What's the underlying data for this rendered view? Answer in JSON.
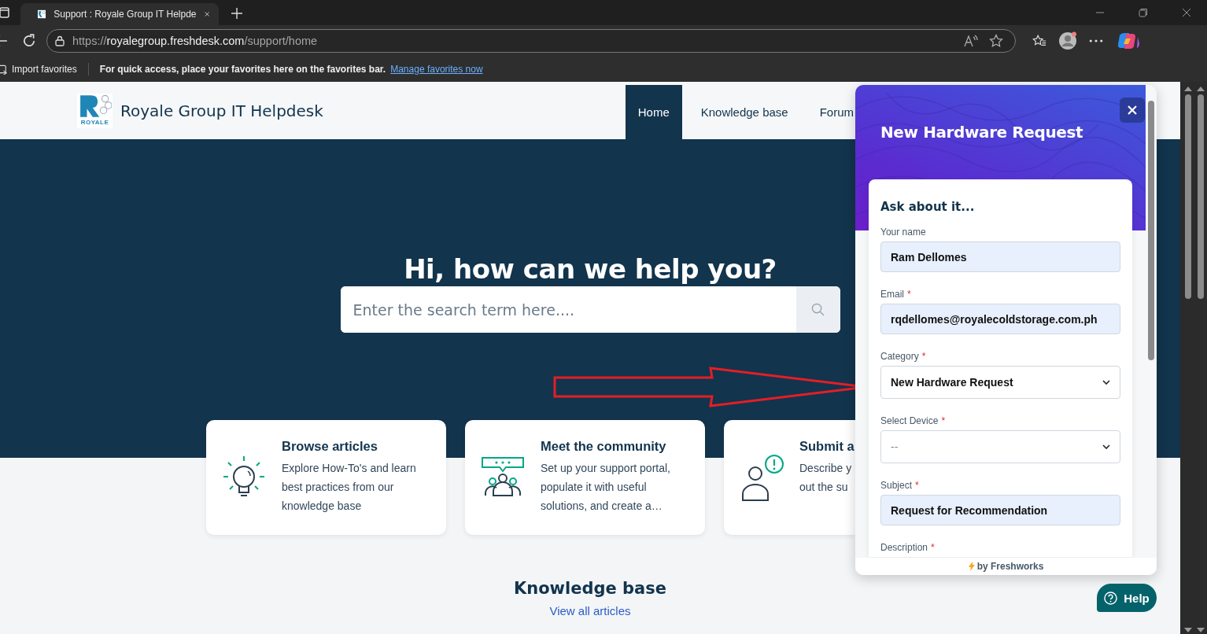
{
  "browser": {
    "tab": {
      "title": "Support : Royale Group IT Helpde",
      "selected": true
    },
    "address": {
      "scheme": "https://",
      "host": "royalegroup.freshdesk.com",
      "path": "/support/home"
    },
    "favorites_bar": {
      "import": "Import favorites",
      "message": "For quick access, place your favorites here on the favorites bar.",
      "link": "Manage favorites now"
    }
  },
  "header": {
    "brand": "Royale Group IT Helpdesk",
    "logo_text": "ROYALE",
    "nav": [
      {
        "label": "Home",
        "selected": true
      },
      {
        "label": "Knowledge base",
        "selected": false
      },
      {
        "label": "Forum",
        "selected": false
      }
    ]
  },
  "hero": {
    "title": "Hi, how can we help you?",
    "search": {
      "placeholder": "Enter the search term here...."
    }
  },
  "cards": [
    {
      "kind": "bulb",
      "title": "Browse articles",
      "lines": [
        "Explore How-To's and learn",
        "best practices from our",
        "knowledge base"
      ]
    },
    {
      "kind": "community",
      "title": "Meet the community",
      "lines": [
        "Set up your support portal,",
        "populate it with useful",
        "solutions, and create a…"
      ]
    },
    {
      "kind": "ticket",
      "title": "Submit a",
      "lines": [
        "Describe y",
        "out the su"
      ]
    }
  ],
  "knowledge_base": {
    "title": "Knowledge base",
    "link": "View all articles"
  },
  "widget": {
    "title": "New Hardware Request",
    "form_title": "Ask about it...",
    "fields": [
      {
        "kind": "text",
        "label": "Your name",
        "value": "Ram Dellomes",
        "autofilled": true
      },
      {
        "kind": "text",
        "label": "Email",
        "required_mark": "*",
        "value": "rqdellomes@royalecoldstorage.com.ph",
        "autofilled": true
      },
      {
        "kind": "select",
        "label": "Category",
        "required_mark": "*",
        "value": "New Hardware Request",
        "autofilled": false
      },
      {
        "kind": "select",
        "label": "Select Device",
        "required_mark": "*",
        "placeholder": "--",
        "autofilled": false
      },
      {
        "kind": "text",
        "label": "Subject",
        "required_mark": "*",
        "value": "Request for Recommendation",
        "autofilled": true
      },
      {
        "kind": "label",
        "label": "Description",
        "required_mark": "*"
      }
    ],
    "footer": "by Freshworks"
  },
  "help_button": "Help"
}
